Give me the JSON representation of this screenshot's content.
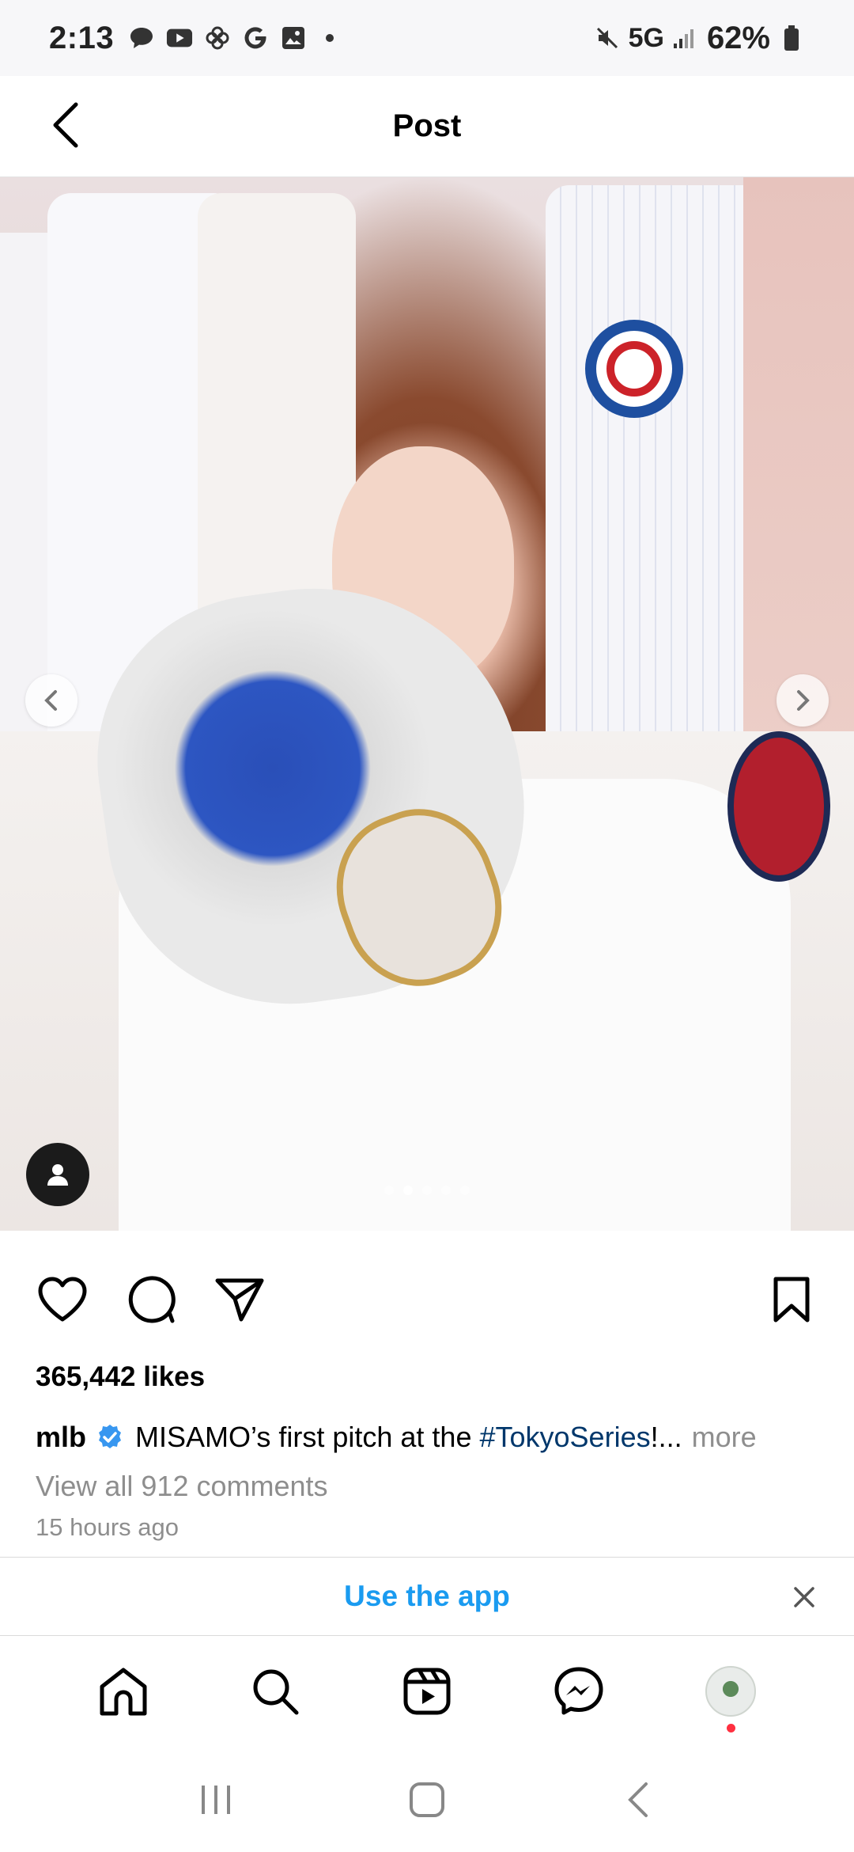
{
  "status_bar": {
    "time": "2:13",
    "network": "5G",
    "battery": "62%",
    "icons": [
      "chat-icon",
      "youtube-icon",
      "pinwheel-icon",
      "google-icon",
      "gallery-icon"
    ]
  },
  "header": {
    "title": "Post"
  },
  "post": {
    "carousel_dots": 5,
    "carousel_active_index": 1,
    "likes": "365,442 likes",
    "caption": {
      "username": "mlb",
      "text_before": "MISAMO’s first pitch at the ",
      "hashtag": "#TokyoSeries",
      "text_after": "!...",
      "more": "more"
    },
    "view_comments": "View all 912 comments",
    "time_ago": "15 hours ago"
  },
  "use_app_banner": {
    "label": "Use the app"
  },
  "colors": {
    "accent_blue": "#1a9bf0",
    "hashtag": "#00376b",
    "muted": "#8e8e8e",
    "verified": "#3897f0"
  }
}
